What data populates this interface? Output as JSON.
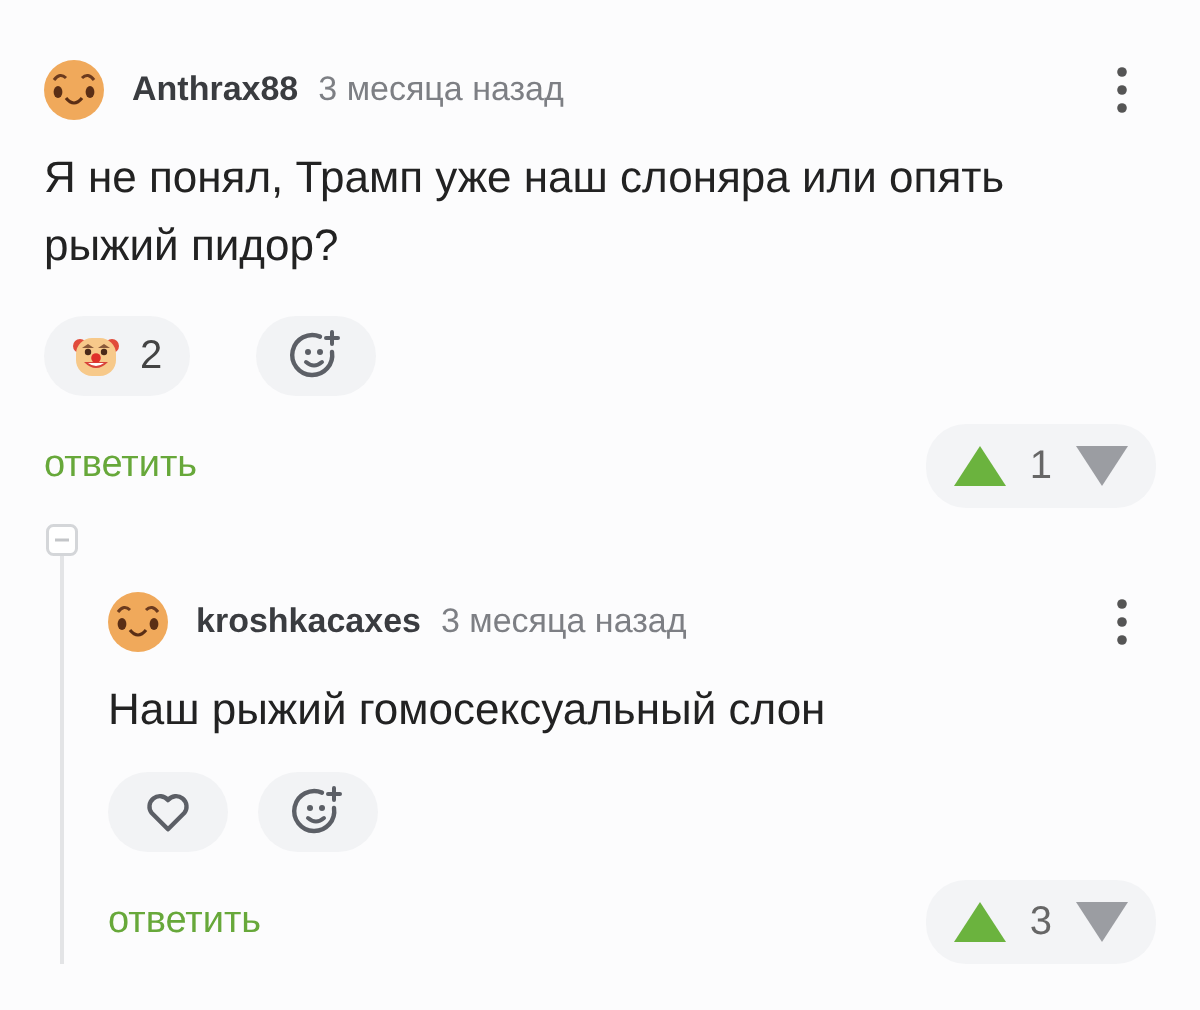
{
  "comments": [
    {
      "author": "Anthrax88",
      "time": "3 месяца назад",
      "text": "Я не понял, Трамп уже наш слоняра или опять рыжий пидор?",
      "reactions": [
        {
          "kind": "clown",
          "count": "2"
        }
      ],
      "reply": "ответить",
      "rating": "1",
      "children": [
        {
          "author": "kroshkacaxes",
          "time": "3 месяца назад",
          "text": "Наш рыжий гомосексуальный слон",
          "reactions": [
            {
              "kind": "heart"
            }
          ],
          "reply": "ответить",
          "rating": "3"
        }
      ]
    }
  ]
}
